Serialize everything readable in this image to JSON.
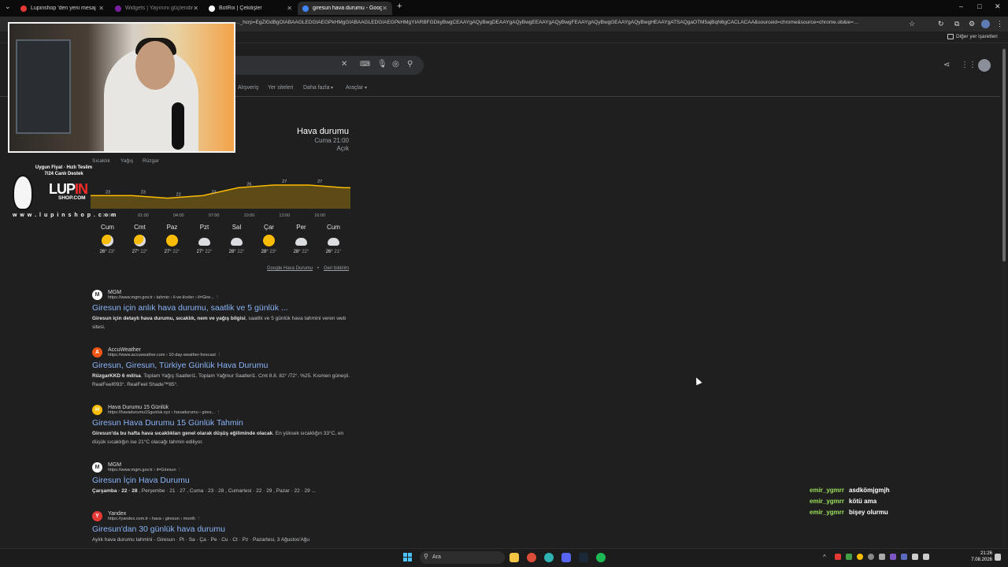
{
  "browser": {
    "tabs": [
      {
        "label": "Lupinshop 'den yeni mesaj",
        "color": "#e53935"
      },
      {
        "label": "Widgets | Yayınını güçlendirmek için...",
        "color": "#7b1fa2"
      },
      {
        "label": "BotRix | Çekilişler",
        "color": "#ffffff"
      },
      {
        "label": "giresun hava durumu - Google'da Ara",
        "color": "#4285f4"
      }
    ],
    "new_tab": "+",
    "url": "…_hcrp=EgZlGdBgOIABAAGLEDGIAEGPkHMgGIABAAGLEDGIAEGPkHMgYIARBFGDkyBwgCEAAYgAQyBwgDEAAYgAQyBwgEEAAYgAQyBwgFEAAYgAQyBwgGEAAYgAQyBwgHEAAYgATSAQgaOTM5ajBqN6gCACLACAA&sourceid=chrome&source=chrome.ob&ie=…",
    "bookmarks_label": "Diğer yer işaretleri"
  },
  "google": {
    "nav": [
      "Alışveriş",
      "Yer siteleri",
      "Daha fazla",
      "Araçlar"
    ]
  },
  "overlay": {
    "promo_line1": "Uygun Fiyat · Hızlı Teslim",
    "promo_line2": "7/24 Canlı Destek",
    "brand_a": "LUP",
    "brand_b": "IN",
    "brand_sub": "SHOP.COM",
    "brand_url": "w w w . l u p i n s h o p . c o m"
  },
  "weather": {
    "title": "Hava durumu",
    "time": "Cuma 21:00",
    "condition": "Açık",
    "tabs": [
      "Sıcaklık",
      "Yağış",
      "Rüzgar"
    ],
    "days": [
      {
        "name": "Cum",
        "icon": "partly-sunny",
        "hi": "26°",
        "lo": "23°"
      },
      {
        "name": "Cmt",
        "icon": "partly-sunny",
        "hi": "27°",
        "lo": "22°"
      },
      {
        "name": "Paz",
        "icon": "sunny",
        "hi": "27°",
        "lo": "22°"
      },
      {
        "name": "Pzt",
        "icon": "rain",
        "hi": "27°",
        "lo": "22°"
      },
      {
        "name": "Sal",
        "icon": "rain",
        "hi": "28°",
        "lo": "22°"
      },
      {
        "name": "Çar",
        "icon": "sunny",
        "hi": "28°",
        "lo": "23°"
      },
      {
        "name": "Per",
        "icon": "rain",
        "hi": "28°",
        "lo": "22°"
      },
      {
        "name": "Cum",
        "icon": "rain",
        "hi": "26°",
        "lo": "21°"
      }
    ],
    "link1": "Google Hava Durumu",
    "link2": "Geri bildirim"
  },
  "chart_data": {
    "type": "area",
    "x": [
      "22:00",
      "01:00",
      "04:00",
      "07:00",
      "10:00",
      "13:00",
      "16:00",
      "19:00"
    ],
    "values": [
      23,
      23,
      22,
      23,
      26,
      27,
      27,
      26
    ],
    "ylim": [
      18,
      30
    ],
    "color": "#fbbc04"
  },
  "results": [
    {
      "icon_text": "M",
      "icon_color": "#ffffff",
      "name": "MGM",
      "url": "https://www.mgm.gov.tr › tahmin › il-ve-ilceler › il=Gire...",
      "title": "Giresun için anlık hava durumu, saatlik ve 5 günlük ...",
      "desc_bold": "Giresun için detaylı hava durumu, sıcaklık, nem ve yağış bilgisi",
      "desc": ", saatlik ve 5 günlük hava tahmini veren web sitesi."
    },
    {
      "icon_text": "A",
      "icon_color": "#f05514",
      "name": "AccuWeather",
      "url": "https://www.accuweather.com › 10-day-weather-forecast",
      "title": "Giresun, Giresun, Türkiye Günlük Hava Durumu",
      "desc_bold": "RüzgarKKD 6 mil/sa",
      "desc": ". Toplam Yağış Saatleri1. Toplam Yağmur Saatleri1. Cmt 8.8. 82° /72°. %25. Kısmen güneşli. RealFeel®93°. RealFeel Shade™85°."
    },
    {
      "icon_text": "H",
      "icon_color": "#fbbc04",
      "name": "Hava Durumu 15 Günlük",
      "url": "https://havadurumu15gunluk.xyz › havadurumu › gires...",
      "title": "Giresun Hava Durumu 15 Günlük Tahmin",
      "desc_bold": "Giresun'da bu hafta hava sıcaklıkları genel olarak düşüş eğiliminde olacak",
      "desc": ". En yüksek sıcaklığın 33°C, en düşük sıcaklığın ise 21°C olacağı tahmin ediliyor."
    },
    {
      "icon_text": "M",
      "icon_color": "#ffffff",
      "name": "MGM",
      "url": "https://www.mgm.gov.tr › il=Giresun",
      "title": "Giresun İçin Hava Durumu",
      "desc_bold": "Çarşamba · 22 · 28",
      "desc": " , Perşembe · 21 · 27 , Cuma · 23 · 28 , Cumartesi · 22 · 29 , Pazar · 22 · 29 ..."
    },
    {
      "icon_text": "Y",
      "icon_color": "#e53935",
      "name": "Yandex",
      "url": "https://yandex.com.tr › hava › giresun › month",
      "title": "Giresun'dan 30 günlük hava durumu",
      "desc_bold": "",
      "desc": "Aylık hava durumu tahmini - Giresun · Pt · Sa · Ça · Pe · Cu · Ct · Pz · Pazartesi, 3 Ağustos'Ağu"
    }
  ],
  "chat": [
    {
      "user": "emir_ygmrr",
      "msg": "asdkömjgmjh"
    },
    {
      "user": "emir_ygmrr",
      "msg": "kötü ama"
    },
    {
      "user": "emir_ygmrr",
      "msg": "bişey olurmu"
    }
  ],
  "taskbar": {
    "search_label": "Ara",
    "time": "21:26",
    "date": "7.08.2026"
  }
}
